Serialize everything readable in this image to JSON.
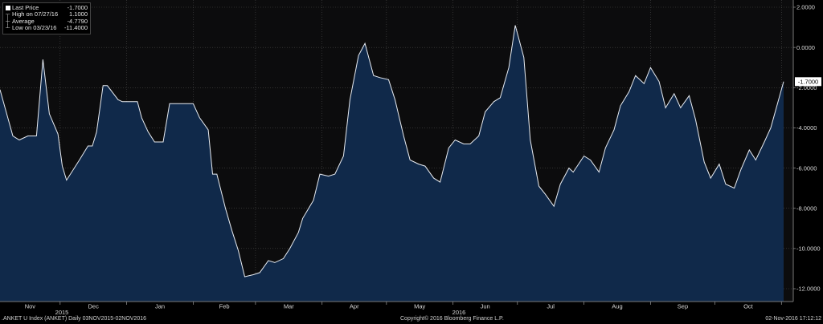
{
  "legend": {
    "last_label": "Last Price",
    "last_value": "-1.7000",
    "high_label": "High on 07/27/16",
    "high_value": "1.1000",
    "avg_label": "Average",
    "avg_value": "-4.7790",
    "low_label": "Low on 03/23/16",
    "low_value": "-11.4000"
  },
  "footer": {
    "left": ".ANKET U Index (ANKET)  Daily 03NOV2015-02NOV2016",
    "center": "Copyright© 2016 Bloomberg Finance L.P.",
    "right": "02-Nov-2016 17:12:12"
  },
  "colors": {
    "fill": "#10294a",
    "line": "#e8ecf2",
    "plot_bg": "#0c0c0d",
    "grid": "#555555"
  },
  "chart_data": {
    "type": "area",
    "ylim": [
      -12.5,
      2.0
    ],
    "yticks": [
      2,
      0,
      -2,
      -4,
      -6,
      -8,
      -10,
      -12
    ],
    "ytick_labels": [
      "2.0000",
      "0.0000",
      "-2.0000",
      "-4.0000",
      "-6.0000",
      "-8.0000",
      "-10.0000",
      "-12.0000"
    ],
    "last_label": "-1.7000",
    "month_labels": [
      "Nov",
      "Dec",
      "Jan",
      "Feb",
      "Mar",
      "Apr",
      "May",
      "Jun",
      "Jul",
      "Aug",
      "Sep",
      "Oct"
    ],
    "year_labels": [
      "2015",
      "2016"
    ],
    "series": [
      {
        "x": [
          "2015-11-03",
          "2015-11-09",
          "2015-11-12",
          "2015-11-16",
          "2015-11-20",
          "2015-11-23",
          "2015-11-26",
          "2015-11-30",
          "2015-12-02",
          "2015-12-04",
          "2015-12-07",
          "2015-12-10",
          "2015-12-14",
          "2015-12-16",
          "2015-12-18",
          "2015-12-21",
          "2015-12-23",
          "2015-12-28",
          "2015-12-30",
          "2016-01-04",
          "2016-01-06",
          "2016-01-08",
          "2016-01-11",
          "2016-01-14",
          "2016-01-18",
          "2016-01-21",
          "2016-01-25",
          "2016-01-28",
          "2016-02-01",
          "2016-02-04",
          "2016-02-08",
          "2016-02-10",
          "2016-02-12",
          "2016-02-16",
          "2016-02-19",
          "2016-02-22",
          "2016-02-25",
          "2016-02-29",
          "2016-03-03",
          "2016-03-07",
          "2016-03-10",
          "2016-03-14",
          "2016-03-17",
          "2016-03-21",
          "2016-03-23",
          "2016-03-28",
          "2016-03-31",
          "2016-04-04",
          "2016-04-07",
          "2016-04-11",
          "2016-04-14",
          "2016-04-18",
          "2016-04-21",
          "2016-04-25",
          "2016-04-28",
          "2016-05-02",
          "2016-05-05",
          "2016-05-09",
          "2016-05-12",
          "2016-05-16",
          "2016-05-19",
          "2016-05-23",
          "2016-05-26",
          "2016-05-30",
          "2016-06-02",
          "2016-06-06",
          "2016-06-09",
          "2016-06-13",
          "2016-06-16",
          "2016-06-20",
          "2016-06-23",
          "2016-06-27",
          "2016-06-30",
          "2016-07-04",
          "2016-07-07",
          "2016-07-11",
          "2016-07-14",
          "2016-07-18",
          "2016-07-21",
          "2016-07-25",
          "2016-07-27",
          "2016-08-01",
          "2016-08-04",
          "2016-08-08",
          "2016-08-11",
          "2016-08-15",
          "2016-08-18",
          "2016-08-22",
          "2016-08-25",
          "2016-08-29",
          "2016-09-01",
          "2016-09-05",
          "2016-09-08",
          "2016-09-12",
          "2016-09-15",
          "2016-09-19",
          "2016-09-22",
          "2016-09-26",
          "2016-09-29",
          "2016-10-03",
          "2016-10-06",
          "2016-10-10",
          "2016-10-13",
          "2016-10-17",
          "2016-10-20",
          "2016-10-24",
          "2016-10-27",
          "2016-11-02"
        ],
        "y": [
          -2.1,
          -4.4,
          -4.6,
          -4.4,
          -4.4,
          -0.6,
          -3.3,
          -4.3,
          -5.9,
          -6.6,
          -6.1,
          -5.6,
          -4.9,
          -4.9,
          -4.2,
          -1.9,
          -1.9,
          -2.6,
          -2.7,
          -2.7,
          -2.7,
          -3.5,
          -4.2,
          -4.7,
          -4.7,
          -2.8,
          -2.8,
          -2.8,
          -2.8,
          -3.5,
          -4.1,
          -6.3,
          -6.3,
          -8.0,
          -9.1,
          -10.1,
          -11.4,
          -11.3,
          -11.2,
          -10.6,
          -10.7,
          -10.5,
          -10.0,
          -9.2,
          -8.5,
          -7.6,
          -6.3,
          -6.4,
          -6.3,
          -5.4,
          -2.6,
          -0.4,
          0.2,
          -1.4,
          -1.5,
          -1.6,
          -2.6,
          -4.4,
          -5.6,
          -5.8,
          -5.9,
          -6.5,
          -6.7,
          -5.0,
          -4.6,
          -4.8,
          -4.8,
          -4.4,
          -3.2,
          -2.7,
          -2.5,
          -1.0,
          1.1,
          -0.5,
          -4.6,
          -6.9,
          -7.3,
          -7.9,
          -6.8,
          -6.0,
          -6.2,
          -5.4,
          -5.6,
          -6.2,
          -5.0,
          -4.1,
          -2.9,
          -2.2,
          -1.4,
          -1.8,
          -1.0,
          -1.7,
          -3.0,
          -2.3,
          -3.0,
          -2.4,
          -3.6,
          -5.7,
          -6.5,
          -5.8,
          -6.8,
          -7.0,
          -6.1,
          -5.1,
          -5.6,
          -4.7,
          -4.0,
          -1.7
        ]
      }
    ]
  }
}
